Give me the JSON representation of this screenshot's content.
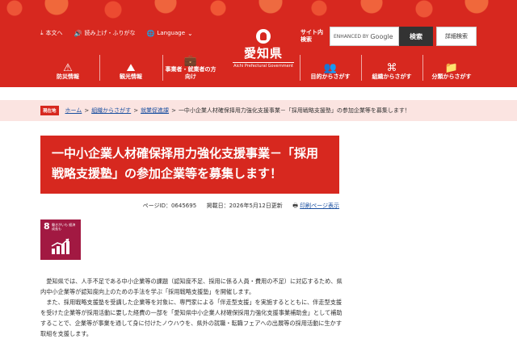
{
  "header": {
    "utility": {
      "text_size": "本文へ",
      "reading": "読み上げ・ふりがな",
      "language": "Language"
    },
    "logo": {
      "name": "愛知県",
      "en": "Aichi Prefectural Government"
    },
    "site_search_label": "サイト内検索",
    "search": {
      "enhanced_by": "ENHANCED BY",
      "google": "Google",
      "button": "検索",
      "advanced": "詳細検索"
    },
    "nav": [
      {
        "label": "防災情報",
        "icon": "disaster-icon"
      },
      {
        "label": "観光情報",
        "icon": "tourism-icon"
      },
      {
        "label": "事業者・就業者の方向け",
        "icon": "briefcase-icon"
      },
      {
        "label": "目的からさがす",
        "icon": "people-icon"
      },
      {
        "label": "組織からさがす",
        "icon": "organization-icon"
      },
      {
        "label": "分類からさがす",
        "icon": "folder-icon"
      }
    ]
  },
  "breadcrumb": {
    "here_label": "現在地",
    "items": [
      "ホーム",
      "組織からさがす",
      "就業促進課"
    ],
    "current": "一中小企業人材確保择用力強化支援事業－「採用戦略支援塾」の参加企業等を募集します！"
  },
  "page": {
    "title": "一中小企業人材確保择用力強化支援事業－「採用戦略支援塾」の参加企業等を募集します！",
    "page_id": "ページID：0645695",
    "published": "掲載日：2026年5月12日更新",
    "print_label": "印刷ページ表示"
  },
  "sdg": {
    "number": "8",
    "label": "働きがいも 経済成長も"
  },
  "body": {
    "paragraph1": "愛知県では、人手不足である中小企業等の課題（認知度不足、採用に係る人員・費用の不足）に対応するため、県内中小企業等が認知度向上のための手法を学ぶ「採用戦略支援塾」を開催します。",
    "paragraph2": "また、採用戦略支援塾を受講した企業等を対象に、専門家による「伴走型支援」を実施するとともに、伴走型支援を受けた企業等が採用活動に要した経費の一部を「愛知県中小企業人材確保採用力強化支援事業補助金」として補助することで、企業等が事業を通して身に付けたノウハウを、県外の就職・転職フェアへの出展等の採用活動に生かす取組を支援します。"
  }
}
